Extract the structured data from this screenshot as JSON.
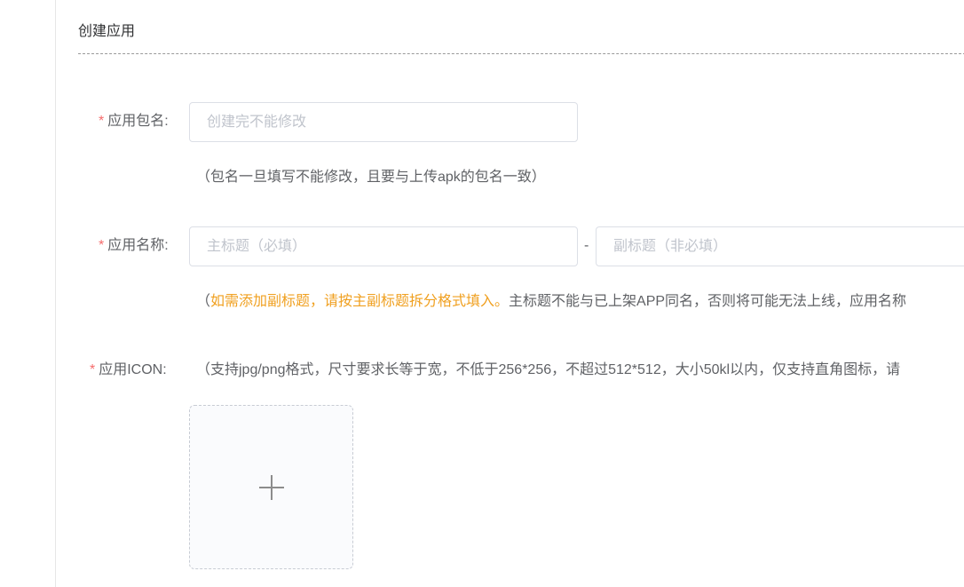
{
  "section": {
    "title": "创建应用"
  },
  "form": {
    "required_mark": "*",
    "package": {
      "label": "应用包名:",
      "placeholder": "创建完不能修改",
      "value": "",
      "hint": "（包名一旦填写不能修改，且要与上传apk的包名一致）"
    },
    "app_name": {
      "label": "应用名称:",
      "main_placeholder": "主标题（必填）",
      "separator": "-",
      "sub_placeholder": "副标题（非必填）",
      "hint_open": "（",
      "hint_warn": "如需添加副标题，请按主副标题拆分格式填入。",
      "hint_rest": "主标题不能与已上架APP同名，否则将可能无法上线，应用名称"
    },
    "icon": {
      "label": "应用ICON:",
      "hint": "（支持jpg/png格式，尺寸要求长等于宽，不低于256*256，不超过512*512，大小50kl以内，仅支持直角图标，请",
      "upload_icon": "plus-icon"
    }
  },
  "colors": {
    "required": "#f56c6c",
    "warning": "#f0a020",
    "text": "#606266",
    "placeholder": "#c0c4cc",
    "border": "#dcdfe6"
  }
}
